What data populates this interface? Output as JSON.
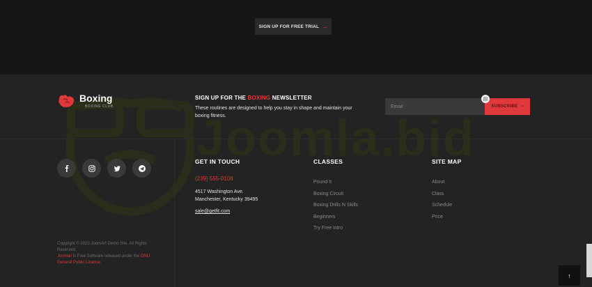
{
  "cta": {
    "label": "SIGN UP FOR FREE TRIAL",
    "arrow": "→"
  },
  "watermark": {
    "text": "Joomla.bid"
  },
  "brand": {
    "name": "Boxing",
    "sub": "BOXING CLUB",
    "accent": "#e0393b"
  },
  "newsletter": {
    "title_prefix": "SIGN UP FOR THE ",
    "title_highlight": "BOXING",
    "title_suffix": " NEWSLETTER",
    "description": "These routines are designed to help you stay in shape and maintain your boxing fitness.",
    "email_placeholder": "Email",
    "subscribe_label": "SUBSCRIBE",
    "subscribe_arrow": "›"
  },
  "socials": [
    "facebook-icon",
    "instagram-icon",
    "twitter-icon",
    "telegram-icon"
  ],
  "contact": {
    "title": "GET IN TOUCH",
    "phone": "(239) 555-0108",
    "address_line1": "4517 Washington Ave.",
    "address_line2": "Manchester, Kentucky 39495",
    "email": "sale@getfit.com"
  },
  "classes": {
    "title": "CLASSES",
    "items": [
      "Pound It",
      "Boxing Circuit",
      "Boxing Drills N Skills",
      "Beginners",
      "Try Free Intro"
    ]
  },
  "sitemap": {
    "title": "SITE MAP",
    "items": [
      "About",
      "Class",
      "Schedule",
      "Price"
    ]
  },
  "copyright": {
    "line1": "Copyright © 2023 JoomArt Demo Site. All Rights Reserved.",
    "joomla": "Joomla!",
    "middle": " is Free Software released under the ",
    "license": "GNU General Public License."
  },
  "back_to_top": "↑"
}
